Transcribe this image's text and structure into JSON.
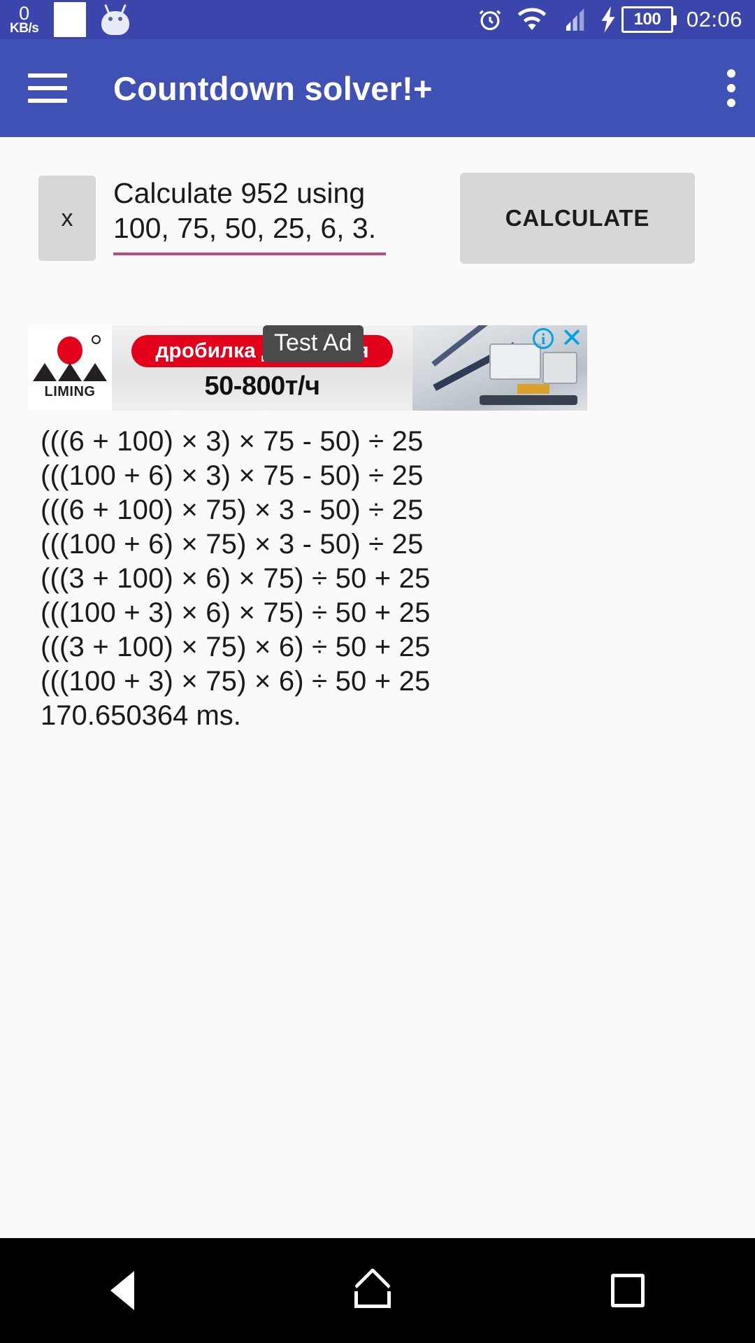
{
  "status_bar": {
    "network_speed_value": "0",
    "network_speed_unit": "KB/s",
    "icons": [
      "white-square-icon",
      "android-head-icon",
      "alarm-icon",
      "wifi-icon",
      "signal-icon",
      "charging-bolt-icon"
    ],
    "battery_level": "100",
    "clock": "02:06",
    "background_color": "#3b46ad"
  },
  "app_bar": {
    "menu_icon": "hamburger-icon",
    "title": "Countdown solver!+",
    "overflow_icon": "overflow-menu-icon",
    "background_color": "#3f51b5"
  },
  "input_area": {
    "clear_button_label": "x",
    "value": "Calculate 952 using\n100, 75, 50, 25, 6, 3.",
    "placeholder": "Calculate 952 using 100, 75, 50, 25, 6, 3.",
    "underline_color": "#c2497f",
    "calculate_button_label": "CALCULATE"
  },
  "ad": {
    "label": "Test Ad",
    "brand": "LIMING",
    "headline": "дробилка для камня",
    "subtext": "50-800т/ч",
    "info_icon_label": "i",
    "close_icon_label": "✕",
    "accent_color": "#e3001b",
    "control_color": "#00a2e8"
  },
  "results": {
    "lines": [
      "(((6 + 100) × 3) × 75 - 50) ÷ 25",
      "(((100 + 6) × 3) × 75 - 50) ÷ 25",
      "(((6 + 100) × 75) × 3 - 50) ÷ 25",
      "(((100 + 6) × 75) × 3 - 50) ÷ 25",
      "(((3 + 100) × 6) × 75) ÷ 50 + 25",
      "(((100 + 3) × 6) × 75) ÷ 50 + 25",
      "(((3 + 100) × 75) × 6) ÷ 50 + 25",
      "(((100 + 3) × 75) × 6) ÷ 50 + 25"
    ],
    "timing": "170.650364 ms."
  },
  "nav_bar": {
    "back_label": "back-icon",
    "home_label": "home-icon",
    "recents_label": "recents-icon",
    "background_color": "#000000"
  }
}
